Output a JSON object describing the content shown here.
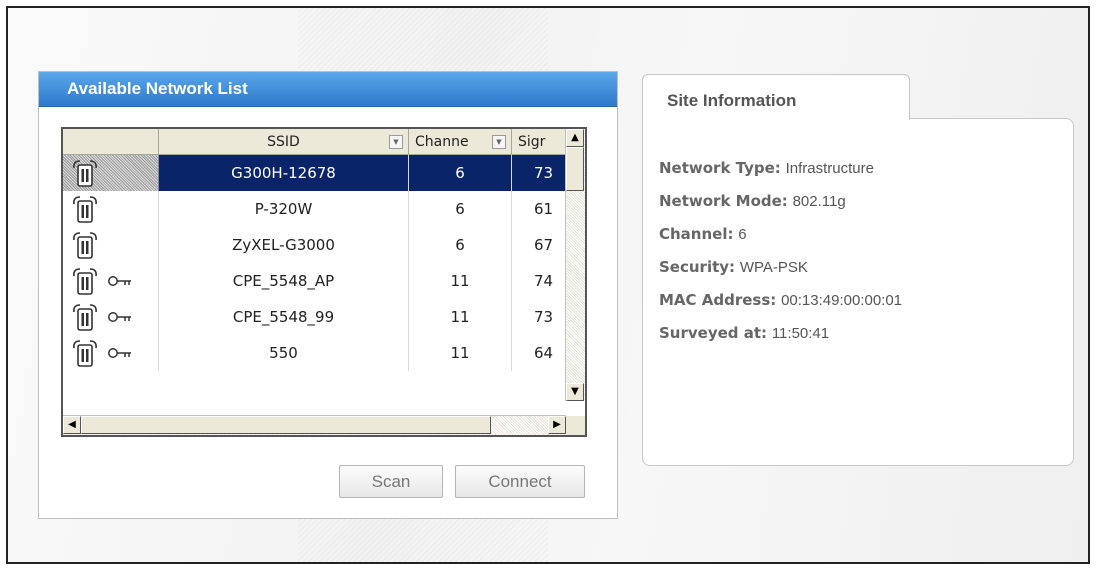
{
  "network_list": {
    "title": "Available Network List",
    "columns": {
      "ssid": "SSID",
      "channel": "Channe",
      "signal": "Sigr"
    },
    "rows": [
      {
        "icon": "wireless-ap-icon",
        "secured": false,
        "ssid": "G300H-12678",
        "channel": "6",
        "signal": "73",
        "selected": true
      },
      {
        "icon": "wireless-ap-icon",
        "secured": false,
        "ssid": "P-320W",
        "channel": "6",
        "signal": "61",
        "selected": false
      },
      {
        "icon": "wireless-ap-icon",
        "secured": false,
        "ssid": "ZyXEL-G3000",
        "channel": "6",
        "signal": "67",
        "selected": false
      },
      {
        "icon": "wireless-ap-icon",
        "secured": true,
        "ssid": "CPE_5548_AP",
        "channel": "11",
        "signal": "74",
        "selected": false
      },
      {
        "icon": "wireless-ap-icon",
        "secured": true,
        "ssid": "CPE_5548_99",
        "channel": "11",
        "signal": "73",
        "selected": false
      },
      {
        "icon": "wireless-ap-icon",
        "secured": true,
        "ssid": "550",
        "channel": "11",
        "signal": "64",
        "selected": false
      }
    ],
    "buttons": {
      "scan": "Scan",
      "connect": "Connect"
    }
  },
  "site_info": {
    "tab_label": "Site Information",
    "network_type_label": "Network Type:",
    "network_type": "Infrastructure",
    "network_mode_label": "Network Mode:",
    "network_mode": "802.11g",
    "channel_label": "Channel:",
    "channel": "6",
    "security_label": "Security:",
    "security": "WPA-PSK",
    "mac_label": "MAC Address:",
    "mac": "00:13:49:00:00:01",
    "surveyed_label": "Surveyed at:",
    "surveyed": "11:50:41"
  }
}
